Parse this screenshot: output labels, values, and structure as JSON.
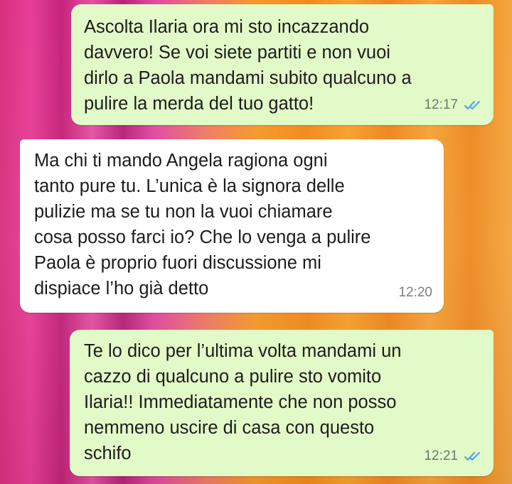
{
  "messages": [
    {
      "direction": "outgoing",
      "text": "Ascolta Ilaria ora mi sto incazzando\ndavvero! Se voi siete partiti e non vuoi\ndirlo a Paola mandami subito qualcuno a\npulire la merda del tuo gatto!",
      "time": "12:17",
      "status_icon": "double-check-read-icon"
    },
    {
      "direction": "incoming",
      "text": "Ma chi ti mando Angela ragiona ogni\ntanto pure tu. L’unica è la signora delle\npulizie ma se tu non la vuoi chiamare\ncosa posso farci io? Che lo venga a pulire\nPaola è proprio fuori discussione mi\ndispiace l’ho già detto",
      "time": "12:20"
    },
    {
      "direction": "outgoing",
      "text": "Te lo dico per l’ultima volta mandami un\ncazzo di qualcuno a pulire sto vomito\nIlaria!! Immediatamente che non posso\nnemmeno uscire di casa con questo\nschifo",
      "time": "12:21",
      "status_icon": "double-check-read-icon"
    }
  ],
  "colors": {
    "outgoing_bubble": "#e2fac8",
    "incoming_bubble": "#ffffff",
    "read_ticks": "#4fa8e0"
  }
}
